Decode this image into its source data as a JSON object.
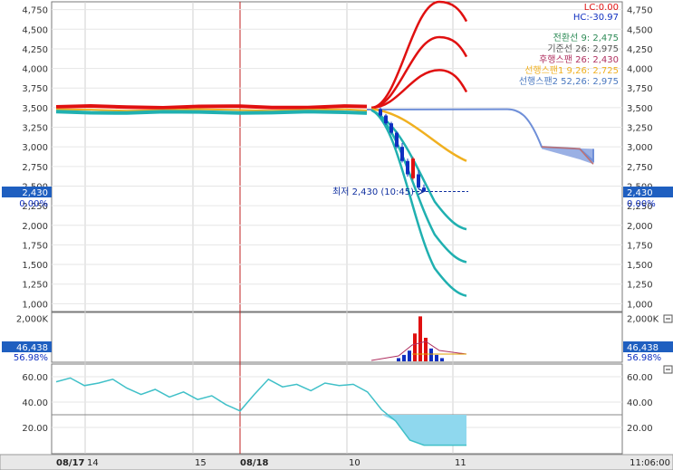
{
  "indicators": {
    "lc": "LC:0.00",
    "hc": "HC:-30.97",
    "legend": [
      {
        "text": "전환선 9: 2,475",
        "color": "#2e8b57"
      },
      {
        "text": "기준선 26: 2,975",
        "color": "#555555"
      },
      {
        "text": "후행스팬 26: 2,430",
        "color": "#b03060"
      },
      {
        "text": "선행스팬1 9,26: 2,725",
        "color": "#f0b020"
      },
      {
        "text": "선행스팬2 52,26: 2,975",
        "color": "#4a78c0"
      }
    ],
    "annotation": "최저 2,430 (10:45)"
  },
  "badges": {
    "price": "2,430",
    "change": "0.00%",
    "volume": "46,438",
    "volume_pct": "56.98%"
  },
  "time_axis": {
    "labels": [
      "08/17",
      "14",
      "15",
      "08/18",
      "10",
      "11"
    ],
    "clock": "11:06:00"
  },
  "colors": {
    "up": "#e01010",
    "down": "#1030c0",
    "teal": "#20b0b0",
    "orange": "#f0b020",
    "blue_cloud": "#6f8fd8",
    "vline": "#c02020",
    "badge_bg": "#1f5fc0"
  },
  "chart_data": [
    {
      "type": "line",
      "title": "price",
      "ylim": [
        900,
        4850
      ],
      "y_ticks": [
        "4,750",
        "4,500",
        "4,250",
        "4,000",
        "3,750",
        "3,500",
        "3,250",
        "3,000",
        "2,750",
        "2,500",
        "2,250",
        "2,000",
        "1,750",
        "1,500",
        "1,250",
        "1,000"
      ],
      "series": [
        {
          "name": "전환선 9",
          "values": [
            3500,
            3500,
            3490,
            3480,
            3475,
            3460,
            3300,
            2800,
            2475
          ]
        },
        {
          "name": "선행스팬1 9,26",
          "values": [
            3480,
            3480,
            3475,
            3470,
            3460,
            3400,
            3200,
            2950,
            2725
          ]
        },
        {
          "name": "선행스팬2 52,26",
          "values": [
            3475,
            3475,
            3475,
            3475,
            3475,
            3450,
            3300,
            3000,
            2975
          ]
        }
      ],
      "upper_bands": [
        4850,
        4400,
        3980
      ],
      "lower_bands": [
        1950,
        1530,
        1100
      ],
      "low_price": 2430
    },
    {
      "type": "bar",
      "title": "volume",
      "ylim": [
        0,
        2200000
      ],
      "y_ticks": [
        "2,000K"
      ],
      "values": [
        150000,
        300000,
        500000,
        1300000,
        2100000,
        1100000,
        600000,
        300000,
        150000
      ],
      "moving_average": 56.98
    },
    {
      "type": "line",
      "title": "oscillator",
      "ylim": [
        0,
        70
      ],
      "y_ticks": [
        "60.00",
        "40.00",
        "20.00"
      ],
      "values": [
        56,
        59,
        53,
        55,
        58,
        51,
        46,
        50,
        44,
        48,
        42,
        45,
        38,
        33,
        46,
        58,
        52,
        54,
        49,
        55,
        53,
        54,
        48,
        34,
        25,
        10,
        6,
        6,
        6,
        6
      ],
      "reference_level": 30
    }
  ]
}
